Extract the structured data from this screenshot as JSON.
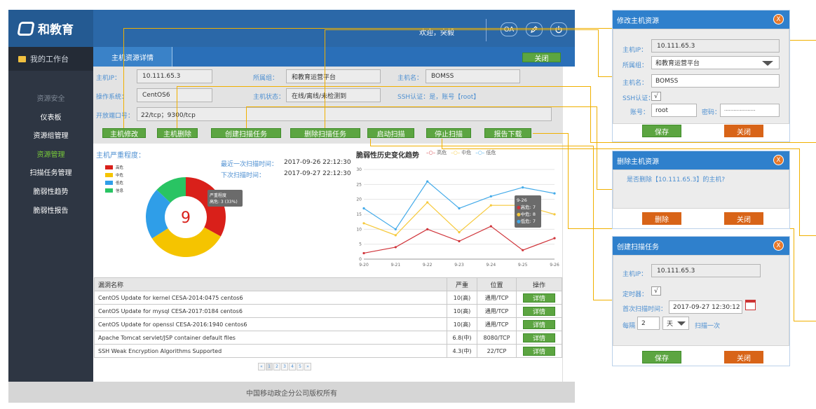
{
  "app": {
    "logo": "和教育",
    "welcome": "欢迎，突毅",
    "oa": "OA",
    "footer": "中国移动政企分公司版权所有"
  },
  "sidebar": {
    "head": "我的工作台",
    "section": "资源安全",
    "items": [
      "仪表板",
      "资源组管理",
      "资源管理",
      "扫描任务管理",
      "脆弱性趋势",
      "脆弱性报告"
    ],
    "active": "资源管理"
  },
  "tab": {
    "title": "主机资源详情",
    "close": "关闭"
  },
  "info": {
    "ip_label": "主机IP：",
    "ip": "10.111.65.3",
    "group_label": "所属组：",
    "group": "和教育运营平台",
    "name_label": "主机名：",
    "name": "BOMSS",
    "os_label": "操作系统：",
    "os": "CentOS6",
    "status_label": "主机状态：",
    "status": "在线/离线/未检测到",
    "ssh": "SSH认证：是，账号【root】",
    "ports_label": "开放端口号：",
    "ports": "22/tcp；9300/tcp"
  },
  "actions": [
    "主机修改",
    "主机删除",
    "创建扫描任务",
    "删除扫描任务",
    "启动扫描",
    "停止扫描",
    "报告下载"
  ],
  "severity": {
    "title": "主机严重程度：",
    "center": "9",
    "last_label": "最近一次扫描时间：",
    "last": "2017-09-26 22:12:30",
    "next_label": "下次扫描时间：",
    "next": "2017-09-27 22:12:30",
    "legend": [
      "高危",
      "中危",
      "低危",
      "信息"
    ],
    "colors": [
      "#d9201a",
      "#f5c400",
      "#2f9ee8",
      "#29c463"
    ],
    "tip_title": "严重程度",
    "tip_value": "高危: 3 (33%)"
  },
  "chart_data": {
    "type": "line",
    "title": "脆弱性历史变化趋势",
    "x": [
      "9-20",
      "9-21",
      "9-22",
      "9-23",
      "9-24",
      "9-25",
      "9-26"
    ],
    "ylim": [
      0,
      30
    ],
    "yticks": [
      0,
      5,
      10,
      15,
      20,
      25,
      30
    ],
    "series": [
      {
        "name": "高危",
        "color": "#d0343a",
        "values": [
          2,
          4,
          10,
          6,
          11,
          3,
          7
        ]
      },
      {
        "name": "中危",
        "color": "#f6c93a",
        "values": [
          12,
          8,
          19,
          9,
          18,
          18,
          15
        ]
      },
      {
        "name": "低危",
        "color": "#42aae9",
        "values": [
          17,
          10,
          26,
          17,
          21,
          24,
          22
        ]
      }
    ],
    "tooltip": {
      "title": "9-26",
      "rows": [
        "高危: 7",
        "中危: 8",
        "低危: 7"
      ]
    }
  },
  "table": {
    "headers": [
      "漏洞名称",
      "严重",
      "位置",
      "操作"
    ],
    "rows": [
      {
        "name": "CentOS Update for kernel CESA-2014:0475 centos6",
        "sev": "10(高)",
        "loc": "通用/TCP",
        "op": "详情"
      },
      {
        "name": "CentOS Update for mysql CESA-2017:0184 centos6",
        "sev": "10(高)",
        "loc": "通用/TCP",
        "op": "详情"
      },
      {
        "name": "CentOS Update for openssl CESA-2016:1940 centos6",
        "sev": "10(高)",
        "loc": "通用/TCP",
        "op": "详情"
      },
      {
        "name": "Apache Tomcat servlet/JSP container default files",
        "sev": "6.8(中)",
        "loc": "8080/TCP",
        "op": "详情"
      },
      {
        "name": "SSH Weak Encryption Algorithms Supported",
        "sev": "4.3(中)",
        "loc": "22/TCP",
        "op": "详情"
      }
    ]
  },
  "pagination": [
    "«",
    "1",
    "2",
    "3",
    "4",
    "5",
    "»"
  ],
  "dialog_edit": {
    "title": "修改主机资源",
    "ip_label": "主机IP：",
    "ip": "10.111.65.3",
    "group_label": "所属组：",
    "group": "和教育运营平台",
    "name_label": "主机名：",
    "name": "BOMSS",
    "ssh_label": "SSH认证：",
    "check": "√",
    "acct_label": "账号：",
    "acct": "root",
    "pwd_label": "密码：",
    "pwd": "····················",
    "save": "保存",
    "close": "关闭"
  },
  "dialog_delete": {
    "title": "删除主机资源",
    "message": "是否删除【10.111.65.3】的主机?",
    "delete": "删除",
    "close": "关闭"
  },
  "dialog_scan": {
    "title": "创建扫描任务",
    "ip_label": "主机IP：",
    "ip": "10.111.65.3",
    "timer_label": "定时器：",
    "check": "√",
    "first_label": "首次扫描时间：",
    "first": "2017-09-27 12:30:12",
    "every": "每隔",
    "num": "2",
    "unit": "天",
    "once": "扫描一次",
    "save": "保存",
    "close": "关闭"
  },
  "x_icon": "X"
}
